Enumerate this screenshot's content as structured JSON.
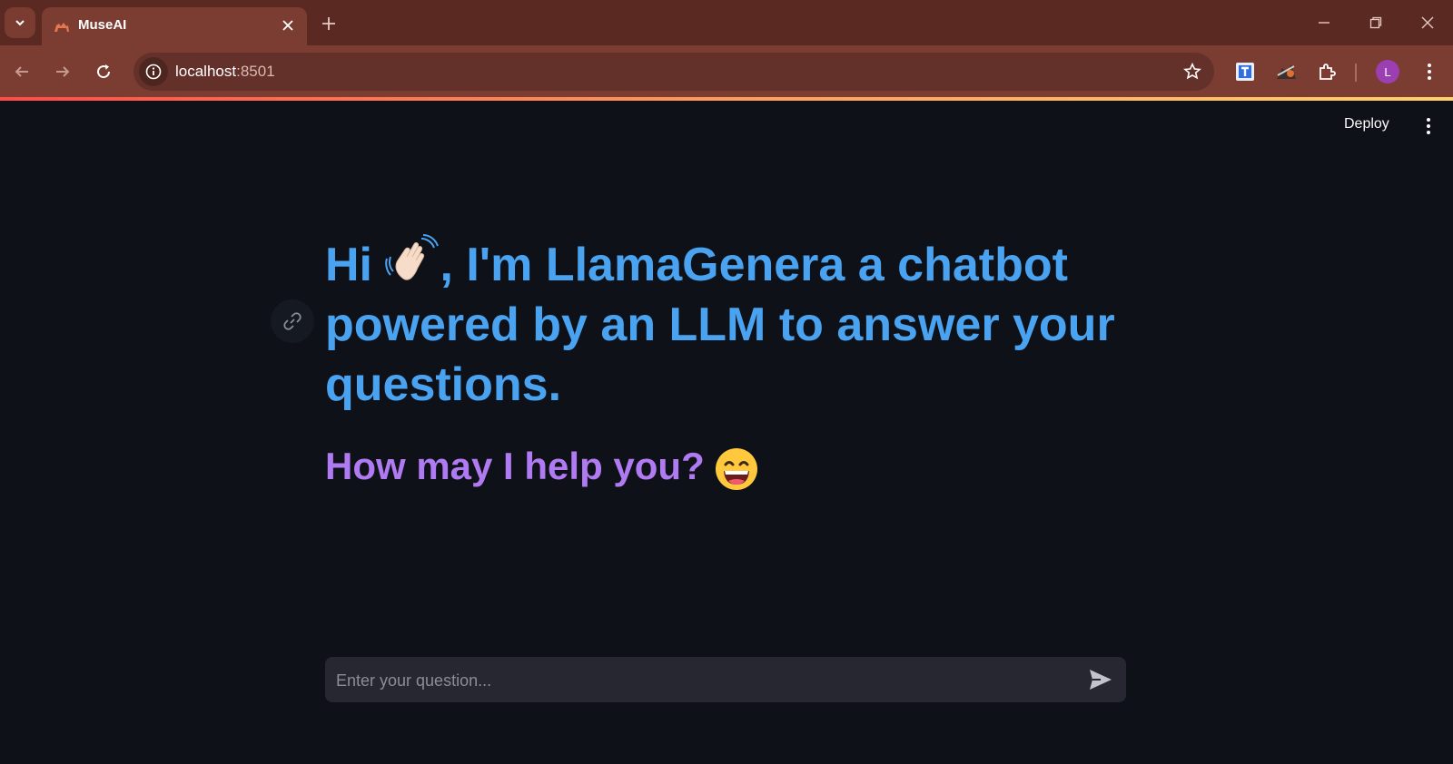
{
  "browser": {
    "tab_title": "MuseAI",
    "url_host": "localhost",
    "url_port": ":8501",
    "profile_initial": "L",
    "accent_colors": {
      "tabbar": "#5a2a22",
      "toolbar": "#7b3c32"
    }
  },
  "app": {
    "deploy_label": "Deploy",
    "heading_part1": "Hi",
    "heading_part2": ", I'm LlamaGenera a chatbot powered by an LLM to answer your questions.",
    "subheading": "How may I help you?",
    "chat_placeholder": "Enter your question...",
    "colors": {
      "heading": "#4aa3f0",
      "subheading": "#b07bf2",
      "background": "#0e1117"
    },
    "icons": [
      "waving-hand-icon",
      "grinning-face-icon",
      "link-icon",
      "send-icon"
    ]
  }
}
